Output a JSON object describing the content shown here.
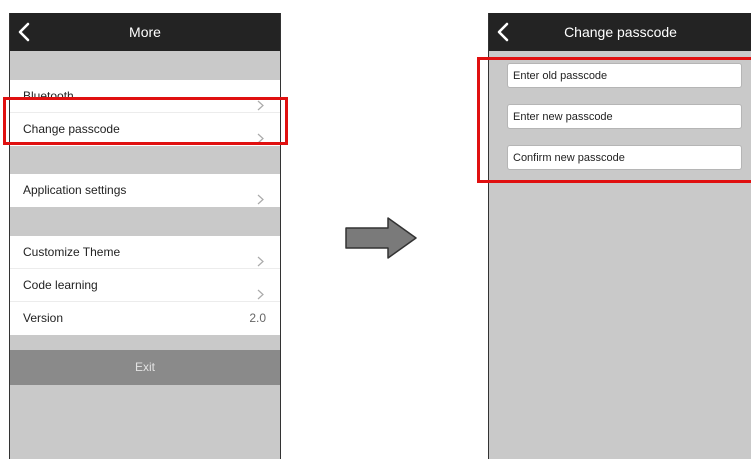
{
  "left_screen": {
    "title": "More",
    "groups": [
      {
        "items": [
          {
            "label": "Bluetooth"
          },
          {
            "label": "Change passcode"
          }
        ]
      },
      {
        "items": [
          {
            "label": "Application settings"
          }
        ]
      },
      {
        "items": [
          {
            "label": "Customize Theme"
          },
          {
            "label": "Code learning"
          },
          {
            "label": "Version",
            "value": "2.0"
          }
        ]
      }
    ],
    "exit_label": "Exit"
  },
  "right_screen": {
    "title": "Change passcode",
    "fields": [
      {
        "placeholder": "Enter old passcode"
      },
      {
        "placeholder": "Enter new passcode"
      },
      {
        "placeholder": "Confirm new passcode"
      }
    ]
  },
  "colors": {
    "navbar": "#232323",
    "screen_background": "#c9c9c9",
    "highlight": "#e01010",
    "exit_button": "#8a8a8a",
    "arrow": "#7a7a7a"
  },
  "icons": {
    "back": "chevron-left-icon",
    "row_disclosure": "chevron-right-icon",
    "transition": "arrow-right-icon"
  }
}
